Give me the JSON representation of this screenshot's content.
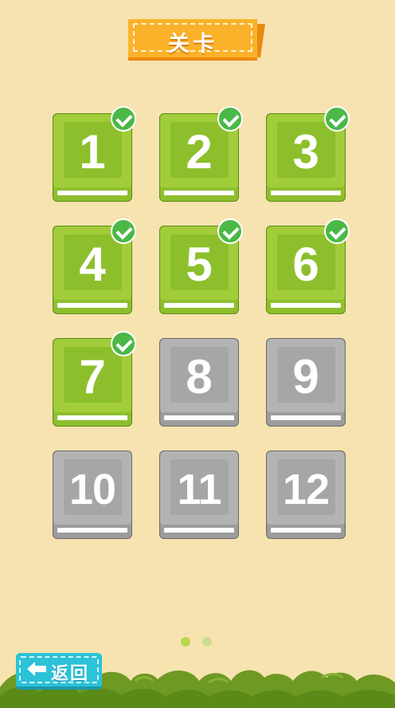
{
  "header": {
    "title": "关卡"
  },
  "levels": [
    {
      "number": "1",
      "state": "completed"
    },
    {
      "number": "2",
      "state": "completed"
    },
    {
      "number": "3",
      "state": "completed"
    },
    {
      "number": "4",
      "state": "completed"
    },
    {
      "number": "5",
      "state": "completed"
    },
    {
      "number": "6",
      "state": "completed"
    },
    {
      "number": "7",
      "state": "completed"
    },
    {
      "number": "8",
      "state": "locked"
    },
    {
      "number": "9",
      "state": "locked"
    },
    {
      "number": "10",
      "state": "locked"
    },
    {
      "number": "11",
      "state": "locked"
    },
    {
      "number": "12",
      "state": "locked"
    }
  ],
  "pager": {
    "current_page": 1,
    "total_pages": 2
  },
  "back_button": {
    "label": "返回",
    "icon": "arrow-left-icon"
  },
  "colors": {
    "background": "#f6e3b0",
    "completed": "#a2cd3a",
    "locked": "#b3b3b3",
    "check": "#4bb847",
    "title_ribbon": "#fbb22a",
    "back_button": "#2cc2d8"
  }
}
